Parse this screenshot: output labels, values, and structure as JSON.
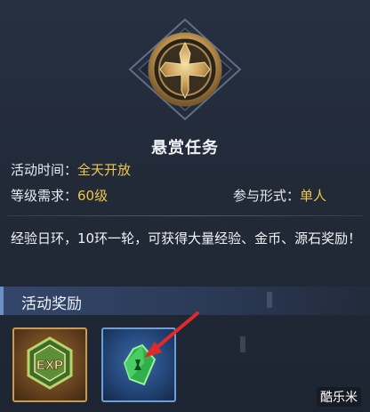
{
  "activity": {
    "title": "悬赏任务",
    "time_label": "活动时间：",
    "time_value": "全天开放",
    "level_label": "等级需求：",
    "level_value": "60级",
    "mode_label": "参与形式：",
    "mode_value": "单人",
    "description": "经验日环，10环一轮，可获得大量经验、金币、源石奖励！"
  },
  "rewards": {
    "header": "活动奖励",
    "items": [
      {
        "name": "EXP",
        "icon": "exp-icon"
      },
      {
        "name": "",
        "icon": "green-crystal-icon"
      }
    ]
  },
  "watermark": "酷乐米",
  "colors": {
    "accent_gold": "#f0c64a",
    "arrow_red": "#e02a2a"
  }
}
